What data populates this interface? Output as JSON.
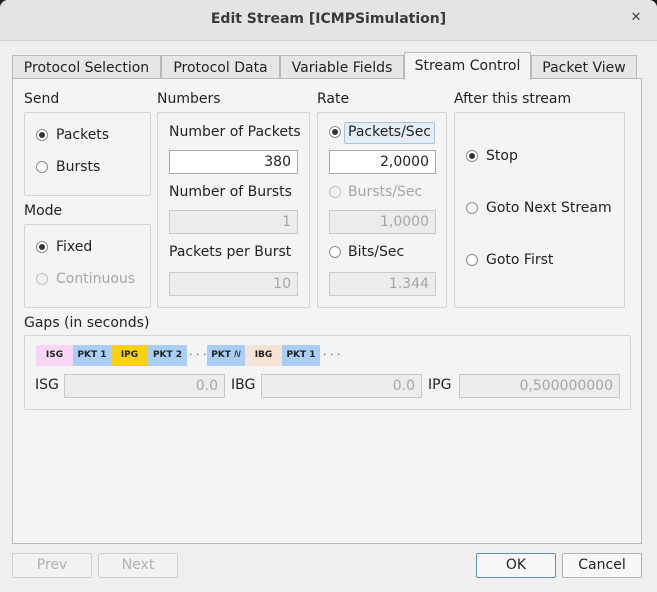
{
  "window": {
    "title": "Edit Stream [ICMPSimulation]"
  },
  "tabs": [
    "Protocol Selection",
    "Protocol Data",
    "Variable Fields",
    "Stream Control",
    "Packet View"
  ],
  "send": {
    "title": "Send",
    "packets": "Packets",
    "bursts": "Bursts"
  },
  "mode": {
    "title": "Mode",
    "fixed": "Fixed",
    "continuous": "Continuous"
  },
  "numbers": {
    "title": "Numbers",
    "num_packets_label": "Number of Packets",
    "num_packets": "380",
    "num_bursts_label": "Number of Bursts",
    "num_bursts": "1",
    "pkts_per_burst_label": "Packets per Burst",
    "pkts_per_burst": "10"
  },
  "rate": {
    "title": "Rate",
    "packets_sec": "Packets/Sec",
    "packets_sec_value": "2,0000",
    "bursts_sec": "Bursts/Sec",
    "bursts_sec_value": "1,0000",
    "bits_sec": "Bits/Sec",
    "bits_sec_value": "1.344"
  },
  "after": {
    "title": "After this stream",
    "stop": "Stop",
    "goto_next": "Goto Next Stream",
    "goto_first": "Goto First"
  },
  "gaps": {
    "title": "Gaps (in seconds)",
    "seg_isg": "ISG",
    "seg_pkt1": "PKT 1",
    "seg_ipg": "IPG",
    "seg_pkt2": "PKT 2",
    "seg_pktn": "PKT",
    "seg_pktn_var": "N",
    "seg_ibg": "IBG",
    "seg_pkt1b": "PKT 1",
    "dots": "· · ·",
    "isg_label": "ISG",
    "isg_value": "0.0",
    "ibg_label": "IBG",
    "ibg_value": "0.0",
    "ipg_label": "IPG",
    "ipg_value": "0,500000000"
  },
  "buttons": {
    "prev": "Prev",
    "next": "Next",
    "ok": "OK",
    "cancel": "Cancel"
  },
  "colors": {
    "isg": "#f7d6f5",
    "pkt": "#a9cdf5",
    "ipg": "#fbd117",
    "ibg": "#f6e3d6"
  }
}
